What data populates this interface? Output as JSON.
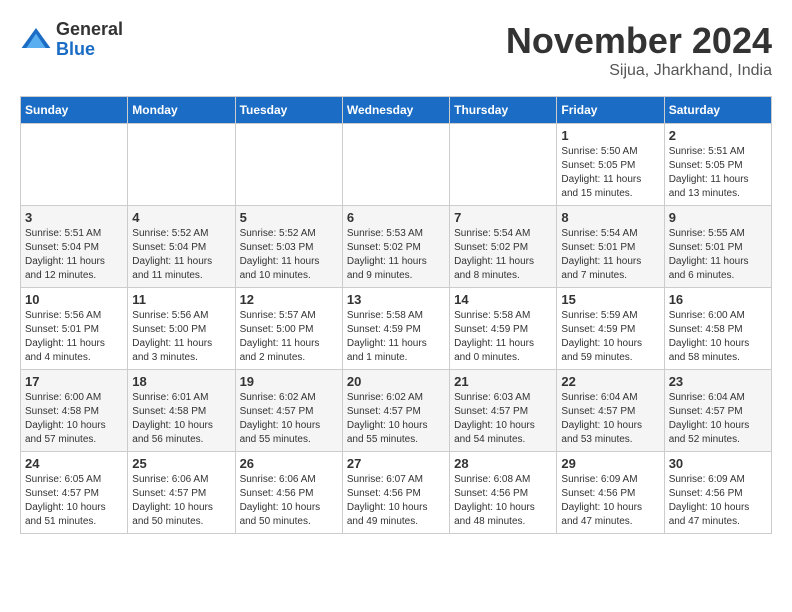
{
  "header": {
    "logo_general": "General",
    "logo_blue": "Blue",
    "month_title": "November 2024",
    "subtitle": "Sijua, Jharkhand, India"
  },
  "days_of_week": [
    "Sunday",
    "Monday",
    "Tuesday",
    "Wednesday",
    "Thursday",
    "Friday",
    "Saturday"
  ],
  "weeks": [
    [
      {
        "day": "",
        "info": ""
      },
      {
        "day": "",
        "info": ""
      },
      {
        "day": "",
        "info": ""
      },
      {
        "day": "",
        "info": ""
      },
      {
        "day": "",
        "info": ""
      },
      {
        "day": "1",
        "info": "Sunrise: 5:50 AM\nSunset: 5:05 PM\nDaylight: 11 hours and 15 minutes."
      },
      {
        "day": "2",
        "info": "Sunrise: 5:51 AM\nSunset: 5:05 PM\nDaylight: 11 hours and 13 minutes."
      }
    ],
    [
      {
        "day": "3",
        "info": "Sunrise: 5:51 AM\nSunset: 5:04 PM\nDaylight: 11 hours and 12 minutes."
      },
      {
        "day": "4",
        "info": "Sunrise: 5:52 AM\nSunset: 5:04 PM\nDaylight: 11 hours and 11 minutes."
      },
      {
        "day": "5",
        "info": "Sunrise: 5:52 AM\nSunset: 5:03 PM\nDaylight: 11 hours and 10 minutes."
      },
      {
        "day": "6",
        "info": "Sunrise: 5:53 AM\nSunset: 5:02 PM\nDaylight: 11 hours and 9 minutes."
      },
      {
        "day": "7",
        "info": "Sunrise: 5:54 AM\nSunset: 5:02 PM\nDaylight: 11 hours and 8 minutes."
      },
      {
        "day": "8",
        "info": "Sunrise: 5:54 AM\nSunset: 5:01 PM\nDaylight: 11 hours and 7 minutes."
      },
      {
        "day": "9",
        "info": "Sunrise: 5:55 AM\nSunset: 5:01 PM\nDaylight: 11 hours and 6 minutes."
      }
    ],
    [
      {
        "day": "10",
        "info": "Sunrise: 5:56 AM\nSunset: 5:01 PM\nDaylight: 11 hours and 4 minutes."
      },
      {
        "day": "11",
        "info": "Sunrise: 5:56 AM\nSunset: 5:00 PM\nDaylight: 11 hours and 3 minutes."
      },
      {
        "day": "12",
        "info": "Sunrise: 5:57 AM\nSunset: 5:00 PM\nDaylight: 11 hours and 2 minutes."
      },
      {
        "day": "13",
        "info": "Sunrise: 5:58 AM\nSunset: 4:59 PM\nDaylight: 11 hours and 1 minute."
      },
      {
        "day": "14",
        "info": "Sunrise: 5:58 AM\nSunset: 4:59 PM\nDaylight: 11 hours and 0 minutes."
      },
      {
        "day": "15",
        "info": "Sunrise: 5:59 AM\nSunset: 4:59 PM\nDaylight: 10 hours and 59 minutes."
      },
      {
        "day": "16",
        "info": "Sunrise: 6:00 AM\nSunset: 4:58 PM\nDaylight: 10 hours and 58 minutes."
      }
    ],
    [
      {
        "day": "17",
        "info": "Sunrise: 6:00 AM\nSunset: 4:58 PM\nDaylight: 10 hours and 57 minutes."
      },
      {
        "day": "18",
        "info": "Sunrise: 6:01 AM\nSunset: 4:58 PM\nDaylight: 10 hours and 56 minutes."
      },
      {
        "day": "19",
        "info": "Sunrise: 6:02 AM\nSunset: 4:57 PM\nDaylight: 10 hours and 55 minutes."
      },
      {
        "day": "20",
        "info": "Sunrise: 6:02 AM\nSunset: 4:57 PM\nDaylight: 10 hours and 55 minutes."
      },
      {
        "day": "21",
        "info": "Sunrise: 6:03 AM\nSunset: 4:57 PM\nDaylight: 10 hours and 54 minutes."
      },
      {
        "day": "22",
        "info": "Sunrise: 6:04 AM\nSunset: 4:57 PM\nDaylight: 10 hours and 53 minutes."
      },
      {
        "day": "23",
        "info": "Sunrise: 6:04 AM\nSunset: 4:57 PM\nDaylight: 10 hours and 52 minutes."
      }
    ],
    [
      {
        "day": "24",
        "info": "Sunrise: 6:05 AM\nSunset: 4:57 PM\nDaylight: 10 hours and 51 minutes."
      },
      {
        "day": "25",
        "info": "Sunrise: 6:06 AM\nSunset: 4:57 PM\nDaylight: 10 hours and 50 minutes."
      },
      {
        "day": "26",
        "info": "Sunrise: 6:06 AM\nSunset: 4:56 PM\nDaylight: 10 hours and 50 minutes."
      },
      {
        "day": "27",
        "info": "Sunrise: 6:07 AM\nSunset: 4:56 PM\nDaylight: 10 hours and 49 minutes."
      },
      {
        "day": "28",
        "info": "Sunrise: 6:08 AM\nSunset: 4:56 PM\nDaylight: 10 hours and 48 minutes."
      },
      {
        "day": "29",
        "info": "Sunrise: 6:09 AM\nSunset: 4:56 PM\nDaylight: 10 hours and 47 minutes."
      },
      {
        "day": "30",
        "info": "Sunrise: 6:09 AM\nSunset: 4:56 PM\nDaylight: 10 hours and 47 minutes."
      }
    ]
  ]
}
